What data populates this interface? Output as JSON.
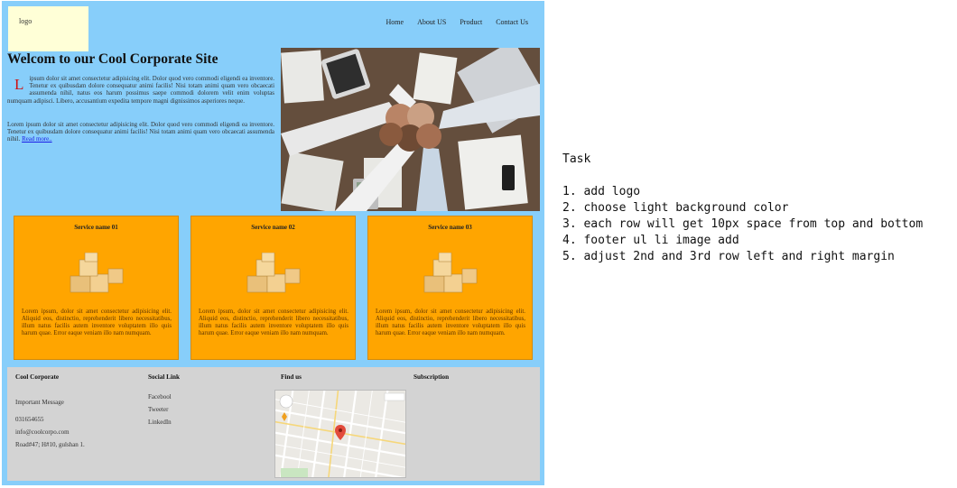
{
  "logo": {
    "text": "logo"
  },
  "nav": [
    "Home",
    "About US",
    "Product",
    "Contact Us"
  ],
  "hero": {
    "title": "Welcom to our Cool Corporate Site",
    "dropcap": "L",
    "p1": "ipsum dolor sit amet consectetur adipisicing elit. Dolor quod vero commodi eligendi ea inventore. Tenetur ex quibusdam dolore consequatur animi facilis! Nisi totam animi quam vero obcaecati assumenda nihil, natus eos harum possimus saepe commodi dolorem velit enim voluptas numquam adipisci. Libero, accusantium expedita tempore magni dignissimos asperiores neque.",
    "p2": "Lorem ipsum dolor sit amet consectetur adipisicing elit. Dolor quod vero commodi eligendi ea inventore. Tenetur ex quibusdam dolore consequatur animi facilis! Nisi totam animi quam vero obcaecati assumenda nihil.",
    "read_more": "Read more.."
  },
  "services": [
    {
      "title": "Service name 01",
      "text": "Lorem ipsum, dolor sit amet consectetur adipisicing elit. Aliquid eos, distinctio, reprehenderit libero necessitatibus, illum natus facilis autem inventore voluptatem illo quis harum quae. Error eaque veniam illo nam numquam."
    },
    {
      "title": "Service name 02",
      "text": "Lorem ipsum, dolor sit amet consectetur adipisicing elit. Aliquid eos, distinctio, reprehenderit libero necessitatibus, illum natus facilis autem inventore voluptatem illo quis harum quae. Error eaque veniam illo nam numquam."
    },
    {
      "title": "Service name 03",
      "text": "Lorem ipsum, dolor sit amet consectetur adipisicing elit. Aliquid eos, distinctio, reprehenderit libero necessitatibus, illum natus facilis autem inventore voluptatem illo quis harum quae. Error eaque veniam illo nam numquam."
    }
  ],
  "footer": {
    "company": {
      "heading": "Cool Corporate",
      "message": "Important Message",
      "phone": "031654655",
      "email": "info@coolcorpo.com",
      "address": "Road#47; H#10, gulshan 1."
    },
    "social": {
      "heading": "Social Link",
      "links": [
        "Facebool",
        "Tweeter",
        "LinkedIn"
      ]
    },
    "find": {
      "heading": "Find us"
    },
    "subscription": {
      "heading": "Subscription"
    }
  },
  "task": {
    "title": "Task",
    "items": [
      "1. add logo",
      "2. choose light background color",
      "3. each row will get 10px space from top and bottom",
      "4. footer ul li image add",
      "5. adjust 2nd and 3rd row left and right margin"
    ]
  },
  "colors": {
    "page_bg": "#87cefa",
    "logo_bg": "#ffffd7",
    "card_bg": "#ffa500",
    "footer_bg": "#d3d3d3",
    "dropcap": "#d01010",
    "link": "#1a1ae6"
  }
}
